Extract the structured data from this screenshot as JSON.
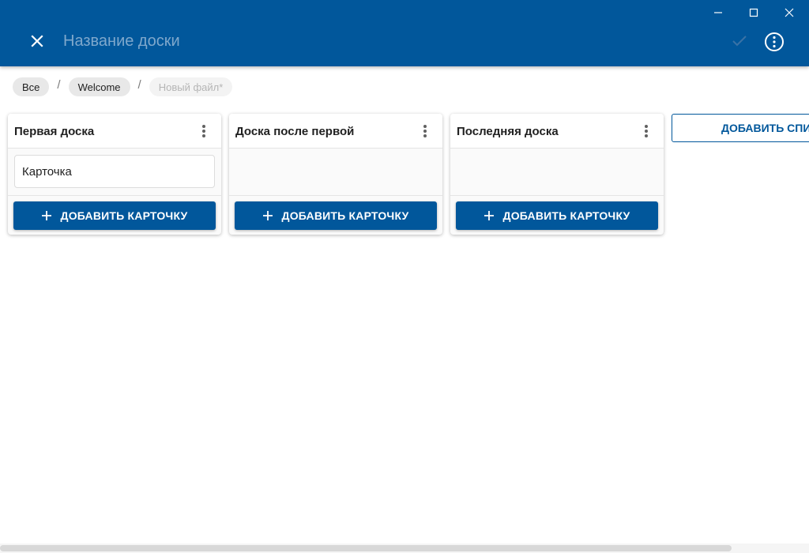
{
  "colors": {
    "appbar": "#01579b",
    "accent": "#01579b",
    "title_placeholder": "#7fa8cc"
  },
  "window": {
    "minimize_icon": "minimize-icon",
    "maximize_icon": "maximize-icon",
    "close_icon": "close-icon"
  },
  "header": {
    "close_icon": "close-icon",
    "title_value": "",
    "title_placeholder": "Название доски",
    "check_icon": "check-icon",
    "more_icon": "more-vertical-circle-icon"
  },
  "breadcrumb": {
    "items": [
      {
        "label": "Все"
      },
      {
        "label": "Welcome"
      },
      {
        "label": "Новый файл*"
      }
    ],
    "separator": "/"
  },
  "boards": [
    {
      "title": "Первая доска",
      "cards": [
        {
          "text": "Карточка"
        }
      ],
      "add_card_label": "ДОБАВИТЬ КАРТОЧКУ"
    },
    {
      "title": "Доска после первой",
      "cards": [],
      "add_card_label": "ДОБАВИТЬ КАРТОЧКУ"
    },
    {
      "title": "Последняя доска",
      "cards": [],
      "add_card_label": "ДОБАВИТЬ КАРТОЧКУ"
    }
  ],
  "add_list_label": "ДОБАВИТЬ СПИСОК"
}
